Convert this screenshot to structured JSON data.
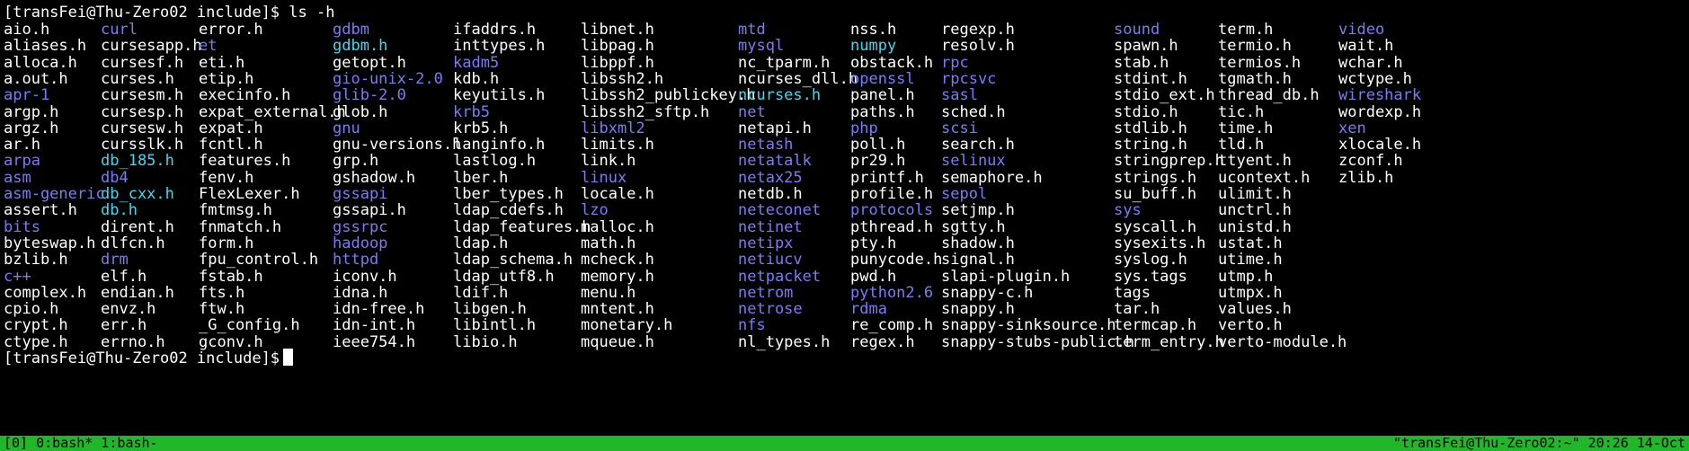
{
  "terminal": {
    "prompt_command": "[transFei@Thu-Zero02 include]$ ls -h",
    "prompt_final": "[transFei@Thu-Zero02 include]$",
    "columns": [
      [
        [
          "aio.h",
          "file"
        ],
        [
          "aliases.h",
          "file"
        ],
        [
          "alloca.h",
          "file"
        ],
        [
          "a.out.h",
          "file"
        ],
        [
          "apr-1",
          "dir"
        ],
        [
          "argp.h",
          "file"
        ],
        [
          "argz.h",
          "file"
        ],
        [
          "ar.h",
          "file"
        ],
        [
          "arpa",
          "dir"
        ],
        [
          "asm",
          "dir"
        ],
        [
          "asm-generic",
          "dir"
        ],
        [
          "assert.h",
          "file"
        ],
        [
          "bits",
          "dir"
        ],
        [
          "byteswap.h",
          "file"
        ],
        [
          "bzlib.h",
          "file"
        ],
        [
          "c++",
          "dir"
        ],
        [
          "complex.h",
          "file"
        ],
        [
          "cpio.h",
          "file"
        ],
        [
          "crypt.h",
          "file"
        ],
        [
          "ctype.h",
          "file"
        ]
      ],
      [
        [
          "curl",
          "dir"
        ],
        [
          "cursesapp.h",
          "file"
        ],
        [
          "cursesf.h",
          "file"
        ],
        [
          "curses.h",
          "file"
        ],
        [
          "cursesm.h",
          "file"
        ],
        [
          "cursesp.h",
          "file"
        ],
        [
          "cursesw.h",
          "file"
        ],
        [
          "cursslk.h",
          "file"
        ],
        [
          "db_185.h",
          "link"
        ],
        [
          "db4",
          "dir"
        ],
        [
          "db_cxx.h",
          "link"
        ],
        [
          "db.h",
          "link"
        ],
        [
          "dirent.h",
          "file"
        ],
        [
          "dlfcn.h",
          "file"
        ],
        [
          "drm",
          "dir"
        ],
        [
          "elf.h",
          "file"
        ],
        [
          "endian.h",
          "file"
        ],
        [
          "envz.h",
          "file"
        ],
        [
          "err.h",
          "file"
        ],
        [
          "errno.h",
          "file"
        ]
      ],
      [
        [
          "error.h",
          "file"
        ],
        [
          "et",
          "dir"
        ],
        [
          "eti.h",
          "file"
        ],
        [
          "etip.h",
          "file"
        ],
        [
          "execinfo.h",
          "file"
        ],
        [
          "expat_external.h",
          "file"
        ],
        [
          "expat.h",
          "file"
        ],
        [
          "fcntl.h",
          "file"
        ],
        [
          "features.h",
          "file"
        ],
        [
          "fenv.h",
          "file"
        ],
        [
          "FlexLexer.h",
          "file"
        ],
        [
          "fmtmsg.h",
          "file"
        ],
        [
          "fnmatch.h",
          "file"
        ],
        [
          "form.h",
          "file"
        ],
        [
          "fpu_control.h",
          "file"
        ],
        [
          "fstab.h",
          "file"
        ],
        [
          "fts.h",
          "file"
        ],
        [
          "ftw.h",
          "file"
        ],
        [
          "_G_config.h",
          "file"
        ],
        [
          "gconv.h",
          "file"
        ]
      ],
      [
        [
          "gdbm",
          "dir"
        ],
        [
          "gdbm.h",
          "link"
        ],
        [
          "getopt.h",
          "file"
        ],
        [
          "gio-unix-2.0",
          "dir"
        ],
        [
          "glib-2.0",
          "dir"
        ],
        [
          "glob.h",
          "file"
        ],
        [
          "gnu",
          "dir"
        ],
        [
          "gnu-versions.h",
          "file"
        ],
        [
          "grp.h",
          "file"
        ],
        [
          "gshadow.h",
          "file"
        ],
        [
          "gssapi",
          "dir"
        ],
        [
          "gssapi.h",
          "file"
        ],
        [
          "gssrpc",
          "dir"
        ],
        [
          "hadoop",
          "dir"
        ],
        [
          "httpd",
          "dir"
        ],
        [
          "iconv.h",
          "file"
        ],
        [
          "idna.h",
          "file"
        ],
        [
          "idn-free.h",
          "file"
        ],
        [
          "idn-int.h",
          "file"
        ],
        [
          "ieee754.h",
          "file"
        ]
      ],
      [
        [
          "ifaddrs.h",
          "file"
        ],
        [
          "inttypes.h",
          "file"
        ],
        [
          "kadm5",
          "dir"
        ],
        [
          "kdb.h",
          "file"
        ],
        [
          "keyutils.h",
          "file"
        ],
        [
          "krb5",
          "dir"
        ],
        [
          "krb5.h",
          "file"
        ],
        [
          "langinfo.h",
          "file"
        ],
        [
          "lastlog.h",
          "file"
        ],
        [
          "lber.h",
          "file"
        ],
        [
          "lber_types.h",
          "file"
        ],
        [
          "ldap_cdefs.h",
          "file"
        ],
        [
          "ldap_features.h",
          "file"
        ],
        [
          "ldap.h",
          "file"
        ],
        [
          "ldap_schema.h",
          "file"
        ],
        [
          "ldap_utf8.h",
          "file"
        ],
        [
          "ldif.h",
          "file"
        ],
        [
          "libgen.h",
          "file"
        ],
        [
          "libintl.h",
          "file"
        ],
        [
          "libio.h",
          "file"
        ]
      ],
      [
        [
          "libnet.h",
          "file"
        ],
        [
          "libpag.h",
          "file"
        ],
        [
          "libppf.h",
          "file"
        ],
        [
          "libssh2.h",
          "file"
        ],
        [
          "libssh2_publickey.h",
          "file"
        ],
        [
          "libssh2_sftp.h",
          "file"
        ],
        [
          "libxml2",
          "dir"
        ],
        [
          "limits.h",
          "file"
        ],
        [
          "link.h",
          "file"
        ],
        [
          "linux",
          "dir"
        ],
        [
          "locale.h",
          "file"
        ],
        [
          "lzo",
          "dir"
        ],
        [
          "malloc.h",
          "file"
        ],
        [
          "math.h",
          "file"
        ],
        [
          "mcheck.h",
          "file"
        ],
        [
          "memory.h",
          "file"
        ],
        [
          "menu.h",
          "file"
        ],
        [
          "mntent.h",
          "file"
        ],
        [
          "monetary.h",
          "file"
        ],
        [
          "mqueue.h",
          "file"
        ]
      ],
      [
        [
          "mtd",
          "dir"
        ],
        [
          "mysql",
          "dir"
        ],
        [
          "nc_tparm.h",
          "file"
        ],
        [
          "ncurses_dll.h",
          "file"
        ],
        [
          "ncurses.h",
          "link"
        ],
        [
          "net",
          "dir"
        ],
        [
          "netapi.h",
          "file"
        ],
        [
          "netash",
          "dir"
        ],
        [
          "netatalk",
          "dir"
        ],
        [
          "netax25",
          "dir"
        ],
        [
          "netdb.h",
          "file"
        ],
        [
          "neteconet",
          "dir"
        ],
        [
          "netinet",
          "dir"
        ],
        [
          "netipx",
          "dir"
        ],
        [
          "netiucv",
          "dir"
        ],
        [
          "netpacket",
          "dir"
        ],
        [
          "netrom",
          "dir"
        ],
        [
          "netrose",
          "dir"
        ],
        [
          "nfs",
          "dir"
        ],
        [
          "nl_types.h",
          "file"
        ]
      ],
      [
        [
          "nss.h",
          "file"
        ],
        [
          "numpy",
          "link"
        ],
        [
          "obstack.h",
          "file"
        ],
        [
          "openssl",
          "dir"
        ],
        [
          "panel.h",
          "file"
        ],
        [
          "paths.h",
          "file"
        ],
        [
          "php",
          "dir"
        ],
        [
          "poll.h",
          "file"
        ],
        [
          "pr29.h",
          "file"
        ],
        [
          "printf.h",
          "file"
        ],
        [
          "profile.h",
          "file"
        ],
        [
          "protocols",
          "dir"
        ],
        [
          "pthread.h",
          "file"
        ],
        [
          "pty.h",
          "file"
        ],
        [
          "punycode.h",
          "file"
        ],
        [
          "pwd.h",
          "file"
        ],
        [
          "python2.6",
          "dir"
        ],
        [
          "rdma",
          "dir"
        ],
        [
          "re_comp.h",
          "file"
        ],
        [
          "regex.h",
          "file"
        ]
      ],
      [
        [
          "regexp.h",
          "file"
        ],
        [
          "resolv.h",
          "file"
        ],
        [
          "rpc",
          "dir"
        ],
        [
          "rpcsvc",
          "dir"
        ],
        [
          "sasl",
          "dir"
        ],
        [
          "sched.h",
          "file"
        ],
        [
          "scsi",
          "dir"
        ],
        [
          "search.h",
          "file"
        ],
        [
          "selinux",
          "dir"
        ],
        [
          "semaphore.h",
          "file"
        ],
        [
          "sepol",
          "dir"
        ],
        [
          "setjmp.h",
          "file"
        ],
        [
          "sgtty.h",
          "file"
        ],
        [
          "shadow.h",
          "file"
        ],
        [
          "signal.h",
          "file"
        ],
        [
          "slapi-plugin.h",
          "file"
        ],
        [
          "snappy-c.h",
          "file"
        ],
        [
          "snappy.h",
          "file"
        ],
        [
          "snappy-sinksource.h",
          "file"
        ],
        [
          "snappy-stubs-public.h",
          "file"
        ]
      ],
      [
        [
          "sound",
          "dir"
        ],
        [
          "spawn.h",
          "file"
        ],
        [
          "stab.h",
          "file"
        ],
        [
          "stdint.h",
          "file"
        ],
        [
          "stdio_ext.h",
          "file"
        ],
        [
          "stdio.h",
          "file"
        ],
        [
          "stdlib.h",
          "file"
        ],
        [
          "string.h",
          "file"
        ],
        [
          "stringprep.h",
          "file"
        ],
        [
          "strings.h",
          "file"
        ],
        [
          "su_buff.h",
          "file"
        ],
        [
          "sys",
          "dir"
        ],
        [
          "syscall.h",
          "file"
        ],
        [
          "sysexits.h",
          "file"
        ],
        [
          "syslog.h",
          "file"
        ],
        [
          "sys.tags",
          "file"
        ],
        [
          "tags",
          "file"
        ],
        [
          "tar.h",
          "file"
        ],
        [
          "termcap.h",
          "file"
        ],
        [
          "term_entry.h",
          "file"
        ]
      ],
      [
        [
          "term.h",
          "file"
        ],
        [
          "termio.h",
          "file"
        ],
        [
          "termios.h",
          "file"
        ],
        [
          "tgmath.h",
          "file"
        ],
        [
          "thread_db.h",
          "file"
        ],
        [
          "tic.h",
          "file"
        ],
        [
          "time.h",
          "file"
        ],
        [
          "tld.h",
          "file"
        ],
        [
          "ttyent.h",
          "file"
        ],
        [
          "ucontext.h",
          "file"
        ],
        [
          "ulimit.h",
          "file"
        ],
        [
          "unctrl.h",
          "file"
        ],
        [
          "unistd.h",
          "file"
        ],
        [
          "ustat.h",
          "file"
        ],
        [
          "utime.h",
          "file"
        ],
        [
          "utmp.h",
          "file"
        ],
        [
          "utmpx.h",
          "file"
        ],
        [
          "values.h",
          "file"
        ],
        [
          "verto.h",
          "file"
        ],
        [
          "verto-module.h",
          "file"
        ]
      ],
      [
        [
          "video",
          "dir"
        ],
        [
          "wait.h",
          "file"
        ],
        [
          "wchar.h",
          "file"
        ],
        [
          "wctype.h",
          "file"
        ],
        [
          "wireshark",
          "dir"
        ],
        [
          "wordexp.h",
          "file"
        ],
        [
          "xen",
          "dir"
        ],
        [
          "xlocale.h",
          "file"
        ],
        [
          "zconf.h",
          "file"
        ],
        [
          "zlib.h",
          "file"
        ]
      ]
    ]
  },
  "status_bar": {
    "left": "[0] 0:bash* 1:bash-",
    "right": "\"transFei@Thu-Zero02:~\" 20:26 14-Oct"
  },
  "colors": {
    "directory": "#7b7cf5",
    "symlink": "#40d9f0",
    "file": "#ffffff",
    "status_bar": "#22b62a"
  }
}
